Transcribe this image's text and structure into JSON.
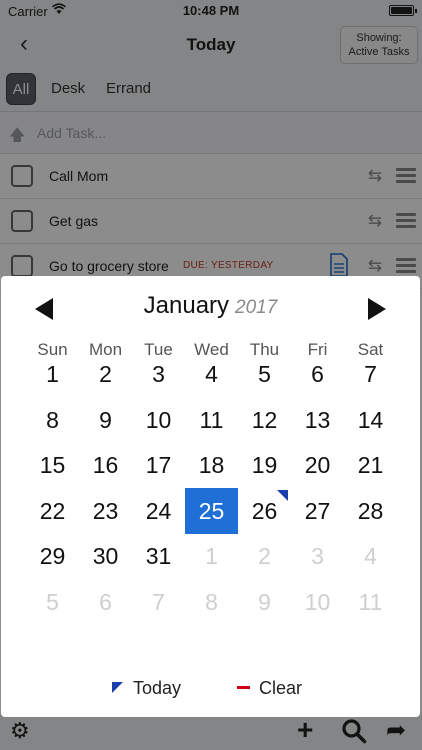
{
  "statusbar": {
    "carrier": "Carrier",
    "time": "10:48 PM"
  },
  "navbar": {
    "back_label": "‹",
    "title": "Today",
    "showing_line1": "Showing:",
    "showing_line2": "Active Tasks"
  },
  "filters": [
    "All",
    "Desk",
    "Errand"
  ],
  "add_task": {
    "placeholder": "Add Task..."
  },
  "tasks": [
    {
      "label": "Call Mom",
      "due": ""
    },
    {
      "label": "Get gas",
      "due": ""
    },
    {
      "label": "Go to grocery store",
      "due": "DUE: YESTERDAY"
    }
  ],
  "calendar": {
    "month": "January",
    "year": "2017",
    "weekdays": [
      "Sun",
      "Mon",
      "Tue",
      "Wed",
      "Thu",
      "Fri",
      "Sat"
    ],
    "weeks": [
      [
        {
          "d": "1"
        },
        {
          "d": "2"
        },
        {
          "d": "3"
        },
        {
          "d": "4"
        },
        {
          "d": "5"
        },
        {
          "d": "6"
        },
        {
          "d": "7"
        }
      ],
      [
        {
          "d": "8"
        },
        {
          "d": "9"
        },
        {
          "d": "10"
        },
        {
          "d": "11"
        },
        {
          "d": "12"
        },
        {
          "d": "13"
        },
        {
          "d": "14"
        }
      ],
      [
        {
          "d": "15"
        },
        {
          "d": "16"
        },
        {
          "d": "17"
        },
        {
          "d": "18"
        },
        {
          "d": "19"
        },
        {
          "d": "20"
        },
        {
          "d": "21"
        }
      ],
      [
        {
          "d": "22"
        },
        {
          "d": "23"
        },
        {
          "d": "24"
        },
        {
          "d": "25",
          "selected": true
        },
        {
          "d": "26",
          "today": true
        },
        {
          "d": "27"
        },
        {
          "d": "28"
        }
      ],
      [
        {
          "d": "29"
        },
        {
          "d": "30"
        },
        {
          "d": "31"
        },
        {
          "d": "1",
          "other": true
        },
        {
          "d": "2",
          "other": true
        },
        {
          "d": "3",
          "other": true
        },
        {
          "d": "4",
          "other": true
        }
      ],
      [
        {
          "d": "5",
          "other": true
        },
        {
          "d": "6",
          "other": true
        },
        {
          "d": "7",
          "other": true
        },
        {
          "d": "8",
          "other": true
        },
        {
          "d": "9",
          "other": true
        },
        {
          "d": "10",
          "other": true
        },
        {
          "d": "11",
          "other": true
        }
      ]
    ],
    "today_label": "Today",
    "clear_label": "Clear"
  },
  "colors": {
    "selected": "#1f6fd6",
    "today_flag": "#1a3fa8",
    "clear": "#d0021b",
    "due": "#c0392b"
  },
  "icons": [
    "wifi-icon",
    "battery-icon",
    "back-chevron-icon",
    "arrow-up-icon",
    "checkbox-icon",
    "note-icon",
    "swap-arrows-icon",
    "drag-handle-icon",
    "gear-icon",
    "plus-icon",
    "search-icon",
    "share-icon",
    "prev-month-icon",
    "next-month-icon"
  ]
}
